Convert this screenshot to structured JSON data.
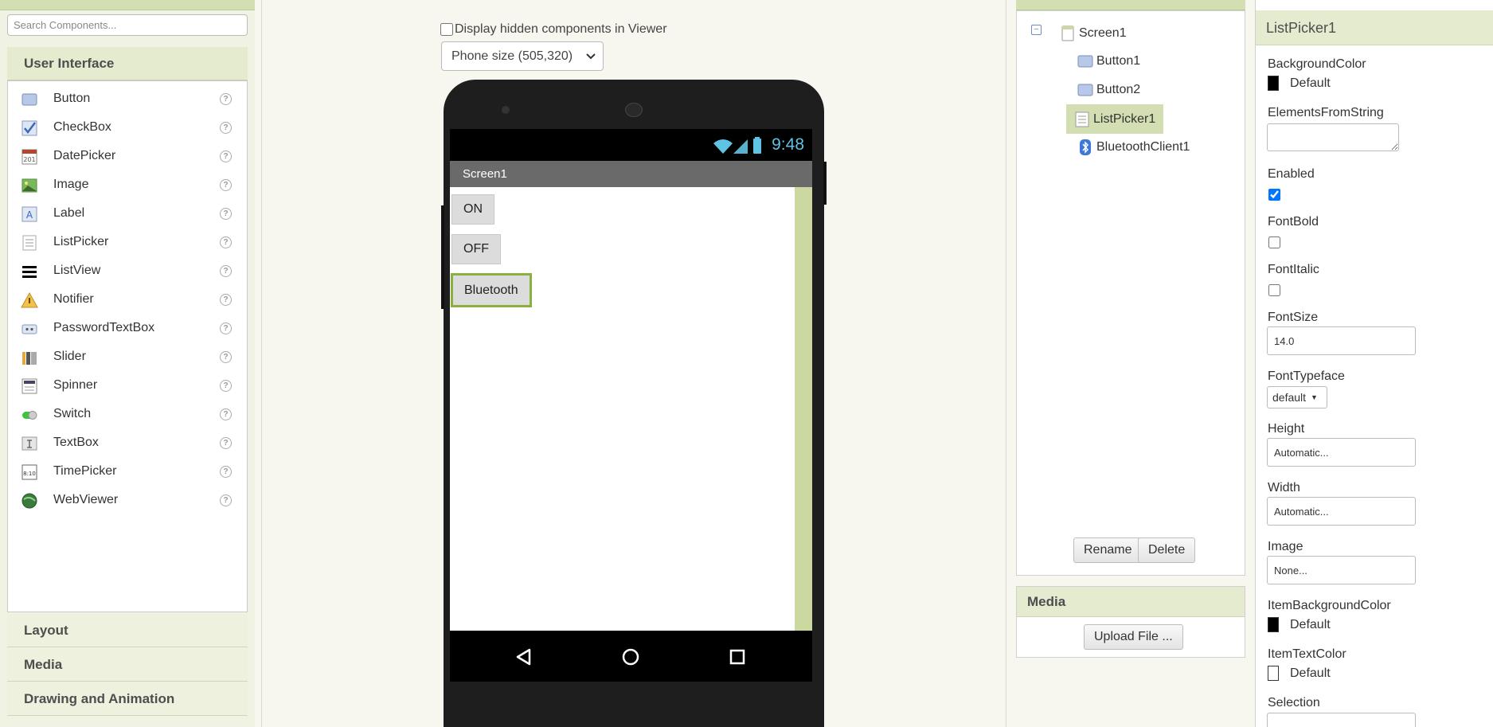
{
  "palette": {
    "search_placeholder": "Search Components...",
    "active_category": "User Interface",
    "components": [
      {
        "label": "Button",
        "icon": "button-icon"
      },
      {
        "label": "CheckBox",
        "icon": "checkbox-icon"
      },
      {
        "label": "DatePicker",
        "icon": "datepicker-icon"
      },
      {
        "label": "Image",
        "icon": "image-icon"
      },
      {
        "label": "Label",
        "icon": "label-icon"
      },
      {
        "label": "ListPicker",
        "icon": "listpicker-icon"
      },
      {
        "label": "ListView",
        "icon": "listview-icon"
      },
      {
        "label": "Notifier",
        "icon": "notifier-icon"
      },
      {
        "label": "PasswordTextBox",
        "icon": "password-icon"
      },
      {
        "label": "Slider",
        "icon": "slider-icon"
      },
      {
        "label": "Spinner",
        "icon": "spinner-icon"
      },
      {
        "label": "Switch",
        "icon": "switch-icon"
      },
      {
        "label": "TextBox",
        "icon": "textbox-icon"
      },
      {
        "label": "TimePicker",
        "icon": "timepicker-icon"
      },
      {
        "label": "WebViewer",
        "icon": "webviewer-icon"
      }
    ],
    "help_glyph": "?",
    "lower_categories": [
      "Layout",
      "Media",
      "Drawing and Animation"
    ]
  },
  "viewer": {
    "hidden_components_label": "Display hidden components in Viewer",
    "phone_size": "Phone size (505,320)",
    "time": "9:48",
    "screen_title": "Screen1",
    "buttons": [
      "ON",
      "OFF",
      "Bluetooth"
    ]
  },
  "tree": {
    "collapse_glyph": "−",
    "root": "Screen1",
    "children": [
      "Button1",
      "Button2",
      "ListPicker1",
      "BluetoothClient1"
    ],
    "selected": "ListPicker1",
    "rename_label": "Rename",
    "delete_label": "Delete"
  },
  "media": {
    "title": "Media",
    "upload_label": "Upload File ..."
  },
  "properties": {
    "component_name": "ListPicker1",
    "background_color_label": "BackgroundColor",
    "background_color_value": "Default",
    "elements_label": "ElementsFromString",
    "enabled_label": "Enabled",
    "enabled": true,
    "fontbold_label": "FontBold",
    "fontitalic_label": "FontItalic",
    "fontsize_label": "FontSize",
    "fontsize_value": "14.0",
    "typeface_label": "FontTypeface",
    "typeface_value": "default",
    "height_label": "Height",
    "height_value": "Automatic...",
    "width_label": "Width",
    "width_value": "Automatic...",
    "image_label": "Image",
    "image_value": "None...",
    "item_bg_label": "ItemBackgroundColor",
    "item_bg_value": "Default",
    "item_text_label": "ItemTextColor",
    "item_text_value": "Default",
    "selection_label": "Selection"
  },
  "colors": {
    "accent_green": "#cbd9a0",
    "header_green": "#d3dfb2",
    "status_time": "#5fc3e4"
  }
}
